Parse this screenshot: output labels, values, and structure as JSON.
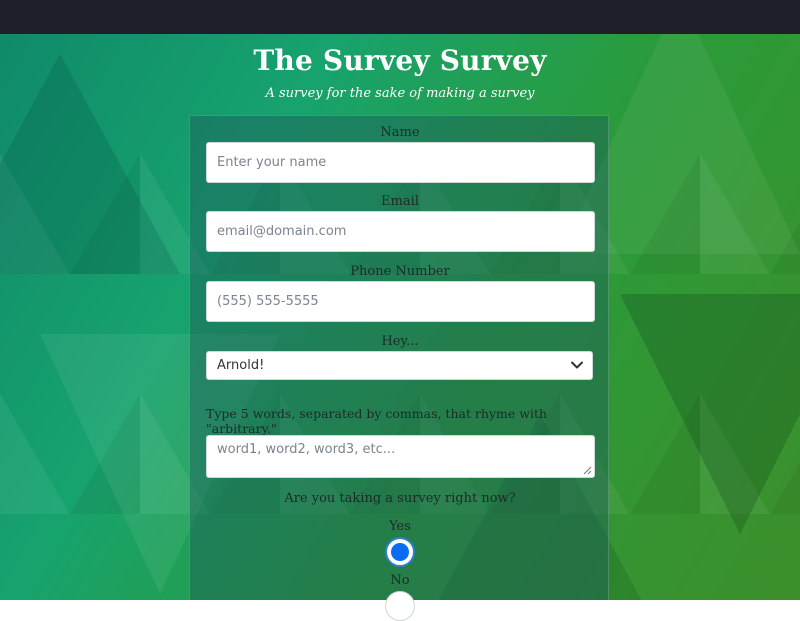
{
  "page": {
    "title": "The Survey Survey",
    "subtitle": "A survey for the sake of making a survey"
  },
  "form": {
    "name": {
      "label": "Name",
      "placeholder": "Enter your name",
      "value": ""
    },
    "email": {
      "label": "Email",
      "placeholder": "email@domain.com",
      "value": ""
    },
    "phone": {
      "label": "Phone Number",
      "placeholder": "(555) 555-5555",
      "value": ""
    },
    "hey": {
      "label": "Hey...",
      "selected": "Arnold!"
    },
    "rhyme": {
      "prompt": "Type 5 words, separated by commas, that rhyme with \"arbitrary.\"",
      "placeholder": "word1, word2, word3, etc..."
    },
    "taking_survey": {
      "question": "Are you taking a survey right now?",
      "options": [
        {
          "label": "Yes",
          "checked": true
        },
        {
          "label": "No",
          "checked": false
        }
      ]
    }
  },
  "colors": {
    "topbar": "#1f1f29",
    "accent_radio": "#0b6cf0"
  },
  "icons": {
    "select_chevron": "chevron-down-icon",
    "textarea_resize": "resize-handle-icon"
  }
}
